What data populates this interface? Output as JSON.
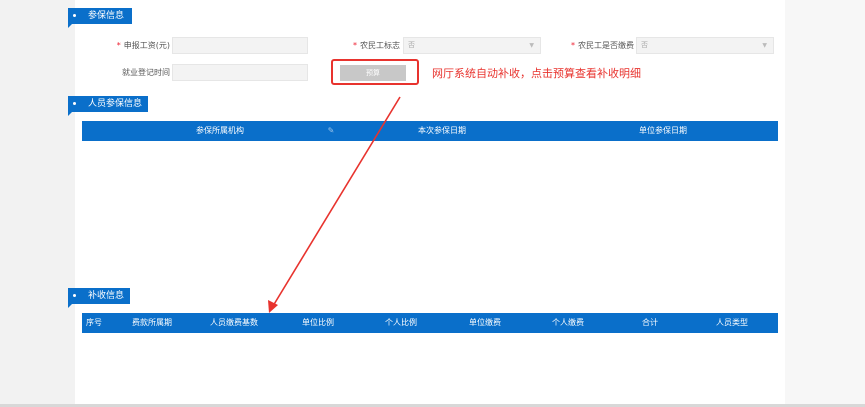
{
  "sections": {
    "insurance": "参保信息",
    "person": "人员参保信息",
    "supplement": "补收信息"
  },
  "form": {
    "wage_label": "申报工资(元)",
    "wage_value": "",
    "migrant_flag_label": "农民工标志",
    "migrant_flag_value": "否",
    "migrant_paid_label": "农民工是否缴费",
    "migrant_paid_value": "否",
    "employ_date_label": "就业登记时间",
    "employ_date_value": "",
    "budget_button": "预算"
  },
  "annotation": "网厅系统自动补收，点击预算查看补收明细",
  "person_table": {
    "columns": [
      "参保所属机构",
      "本次参保日期",
      "单位参保日期"
    ]
  },
  "supplement_table": {
    "columns": [
      "序号",
      "费款所属期",
      "人员缴费基数",
      "单位比例",
      "个人比例",
      "单位缴费",
      "个人缴费",
      "合计",
      "人员类型"
    ]
  },
  "colors": {
    "primary": "#0a6fca",
    "annotation": "#e8332e"
  }
}
